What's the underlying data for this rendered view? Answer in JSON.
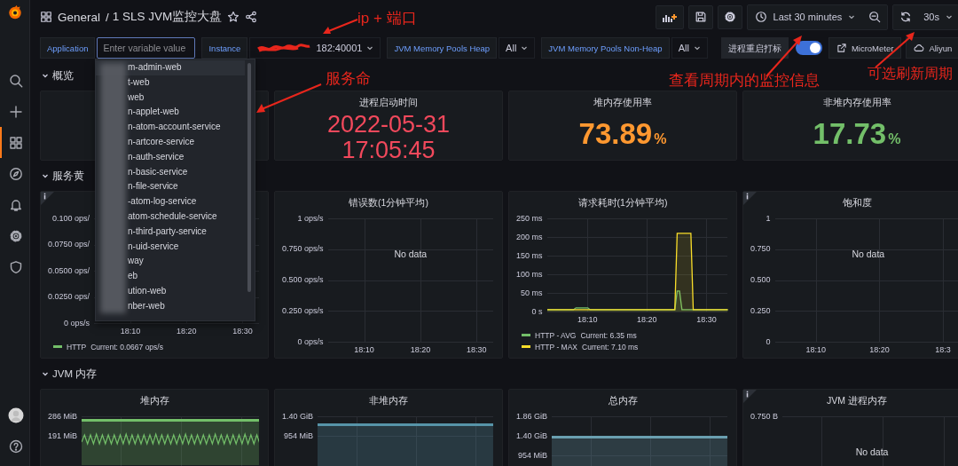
{
  "sidebar": {
    "items": [
      {
        "kind": "search",
        "selected": false
      },
      {
        "kind": "create",
        "selected": false
      },
      {
        "kind": "dashboards",
        "selected": true
      },
      {
        "kind": "explore",
        "selected": false
      },
      {
        "kind": "alerting",
        "selected": false
      },
      {
        "kind": "configuration",
        "selected": false
      },
      {
        "kind": "admin",
        "selected": false
      }
    ],
    "bottom": [
      {
        "kind": "profile"
      },
      {
        "kind": "help"
      }
    ]
  },
  "header": {
    "folder": "General",
    "separator": "/",
    "title": "1 SLS JVM监控大盘",
    "starred": false,
    "time_range": "Last 30 minutes",
    "refresh_interval": "30s"
  },
  "variables": [
    {
      "kind": "input",
      "label": "Application",
      "placeholder": "Enter variable value",
      "focused": true
    },
    {
      "kind": "select",
      "label": "Instance",
      "value": "182:40001",
      "redacted": true
    },
    {
      "kind": "select",
      "label": "JVM Memory Pools Heap",
      "value": "All"
    },
    {
      "kind": "select",
      "label": "JVM Memory Pools Non-Heap",
      "value": "All"
    },
    {
      "kind": "toggle",
      "label": "进程重启打标",
      "on": true
    }
  ],
  "links": [
    {
      "kind": "external",
      "label": "MicroMeter"
    },
    {
      "kind": "cloud",
      "label": "Aliyun"
    }
  ],
  "rows": [
    {
      "title": "概览",
      "expanded": true,
      "panels": [
        {
          "kind": "blank"
        },
        {
          "kind": "stat",
          "title": "进程启动时间",
          "value_lines": [
            "2022-05-31",
            "17:05:45"
          ],
          "color": "#f2495c"
        },
        {
          "kind": "stat",
          "title": "堆内存使用率",
          "value_lines": [
            "73.89"
          ],
          "unit": "%",
          "color": "#ff9830"
        },
        {
          "kind": "stat",
          "title": "非堆内存使用率",
          "value_lines": [
            "17.73"
          ],
          "unit": "%",
          "color": "#73bf69"
        }
      ]
    },
    {
      "title": "服务黄",
      "expanded": true,
      "panels": [
        {
          "kind": "graph",
          "info": true,
          "y_ticks": [
            "0.100 ops/",
            "0.0750 ops/",
            "0.0500 ops/",
            "0.0250 ops/",
            "0 ops/s"
          ],
          "x_ticks": [
            "18:10",
            "18:20",
            "18:30"
          ],
          "legend": [
            {
              "name": "HTTP",
              "current": "Current: 0.0667 ops/s",
              "color": "#73bf69"
            }
          ]
        },
        {
          "kind": "graph",
          "title": "错误数(1分钟平均)",
          "y_ticks": [
            "1 ops/s",
            "0.750 ops/s",
            "0.500 ops/s",
            "0.250 ops/s",
            "0 ops/s"
          ],
          "x_ticks": [
            "18:10",
            "18:20",
            "18:30"
          ],
          "no_data": "No data"
        },
        {
          "kind": "graph",
          "title": "请求耗时(1分钟平均)",
          "chart_data": {
            "type": "area",
            "x": [
              1083.2,
              1087.6,
              1088,
              1090,
              1090.4,
              1104.6,
              1105,
              1105.4,
              1105.8,
              1106.1,
              1107.3,
              1107.7,
              1113.5
            ],
            "xlim": [
              1083.2,
              1113.5
            ],
            "ylim": [
              0,
              250
            ],
            "xticks": [
              {
                "value": 1090,
                "label": "18:10"
              },
              {
                "value": 1100,
                "label": "18:20"
              },
              {
                "value": 1110,
                "label": "18:30"
              }
            ],
            "yticks": [
              {
                "value": 0,
                "label": "0 s"
              },
              {
                "value": 50,
                "label": "50 ms"
              },
              {
                "value": 100,
                "label": "100 ms"
              },
              {
                "value": 150,
                "label": "150 ms"
              },
              {
                "value": 200,
                "label": "200 ms"
              },
              {
                "value": 250,
                "label": "250 ms"
              }
            ],
            "series": [
              {
                "name": "HTTP - AVG",
                "color": "#73bf69",
                "values": [
                  5,
                  5,
                  10,
                  10,
                  5,
                  5,
                  55,
                  55,
                  5,
                  5,
                  5,
                  5,
                  5
                ]
              },
              {
                "name": "HTTP - MAX",
                "color": "#fade2a",
                "values": [
                  5,
                  5,
                  5,
                  5,
                  5,
                  5,
                  210,
                  210,
                  210,
                  210,
                  210,
                  5,
                  5
                ]
              }
            ]
          },
          "legend": [
            {
              "current": "Current: 6.35 ms"
            },
            {
              "current": "Current: 7.10 ms"
            }
          ]
        },
        {
          "kind": "graph",
          "info": true,
          "title": "饱和度",
          "y_ticks": [
            "1",
            "0.750",
            "0.500",
            "0.250",
            "0"
          ],
          "x_ticks": [
            "18:10",
            "18:20",
            "18:3"
          ],
          "no_data": "No data"
        }
      ]
    },
    {
      "title": "JVM 内存",
      "expanded": true,
      "panels": [
        {
          "kind": "area",
          "title": "堆内存",
          "y_ticks": [
            "286 MiB",
            "191 MiB"
          ],
          "color": "#73bf69",
          "wave": true
        },
        {
          "kind": "area",
          "title": "非堆内存",
          "y_ticks": [
            "1.40 GiB",
            "954 MiB"
          ],
          "color": "#5794a8",
          "wave": false
        },
        {
          "kind": "area",
          "title": "总内存",
          "y_ticks": [
            "1.86 GiB",
            "1.40 GiB",
            "954 MiB"
          ],
          "color": "#6a9fb0",
          "wave": false
        },
        {
          "kind": "graph",
          "info": true,
          "title": "JVM 进程内存",
          "y_ticks": [
            "0.750 B"
          ],
          "no_data": "No data"
        }
      ]
    }
  ],
  "dropdown": {
    "options": [
      {
        "label": "m-admin-web",
        "selected": true
      },
      {
        "label": "t-web",
        "selected": false
      },
      {
        "label": "web",
        "selected": false
      },
      {
        "label": "n-applet-web",
        "selected": false
      },
      {
        "label": "n-atom-account-service",
        "selected": false
      },
      {
        "label": "n-artcore-service",
        "selected": false
      },
      {
        "label": "n-auth-service",
        "selected": false
      },
      {
        "label": "n-basic-service",
        "selected": false
      },
      {
        "label": "n-file-service",
        "selected": false
      },
      {
        "label": "-atom-log-service",
        "selected": false
      },
      {
        "label": "atom-schedule-service",
        "selected": false
      },
      {
        "label": "n-third-party-service",
        "selected": false
      },
      {
        "label": "n-uid-service",
        "selected": false
      },
      {
        "label": "way",
        "selected": false
      },
      {
        "label": "eb",
        "selected": false
      },
      {
        "label": "ution-web",
        "selected": false
      },
      {
        "label": "nber-web",
        "selected": false
      }
    ]
  },
  "annotations": [
    {
      "text": "ip + 端口"
    },
    {
      "text": "服务命"
    },
    {
      "text": "查看周期内的监控信息"
    },
    {
      "text": "可选刷新周期"
    }
  ]
}
